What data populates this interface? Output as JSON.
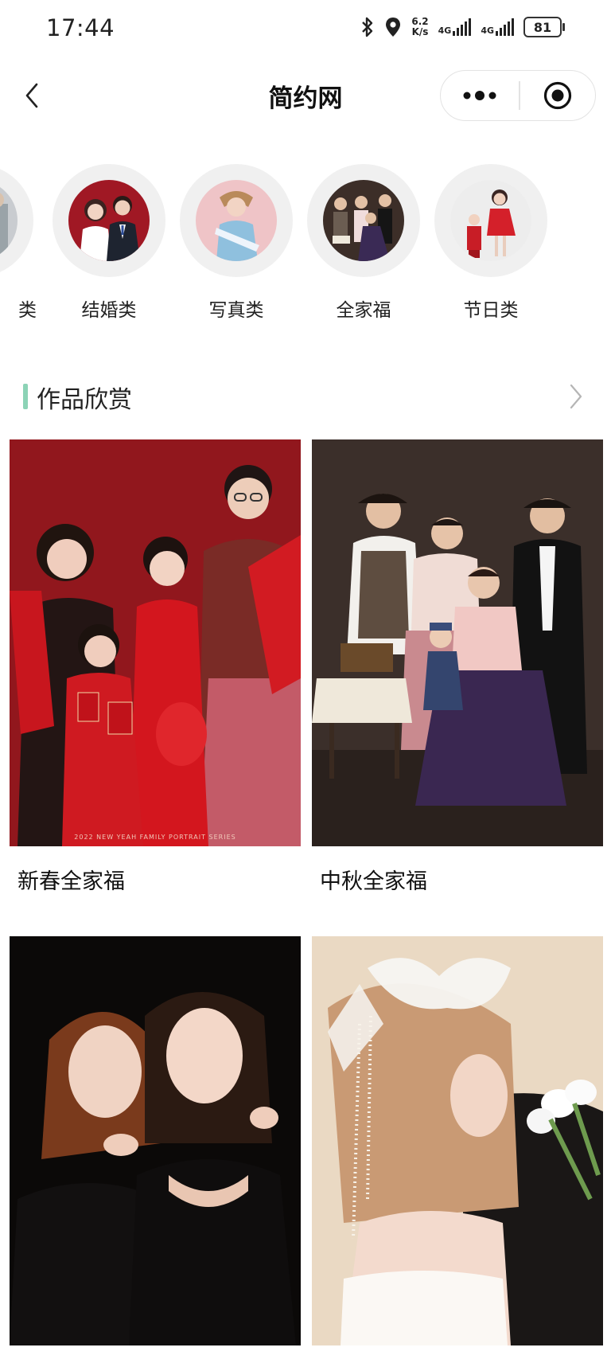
{
  "status_bar": {
    "time": "17:44",
    "net_speed_value": "6.2",
    "net_speed_unit": "K/s",
    "sim1": "4G",
    "sim2": "4G",
    "battery": "81",
    "icons": [
      "bluetooth-icon",
      "location-icon",
      "signal-icon",
      "battery-icon"
    ]
  },
  "nav": {
    "title": "简约网",
    "back_icon": "chevron-left-icon",
    "more_icon": "more-dots-icon",
    "close_icon": "target-close-icon"
  },
  "categories": [
    {
      "label": "类"
    },
    {
      "label": "结婚类"
    },
    {
      "label": "写真类"
    },
    {
      "label": "全家福"
    },
    {
      "label": "节日类"
    }
  ],
  "section": {
    "title": "作品欣赏",
    "arrow_icon": "chevron-right-icon",
    "accent": "#8cd3b6"
  },
  "gallery": [
    {
      "title": "新春全家福",
      "image_text": "2022 NEW YEAH FAMILY PORTRAIT SERIES"
    },
    {
      "title": "中秋全家福"
    },
    {
      "title": ""
    },
    {
      "title": ""
    }
  ]
}
